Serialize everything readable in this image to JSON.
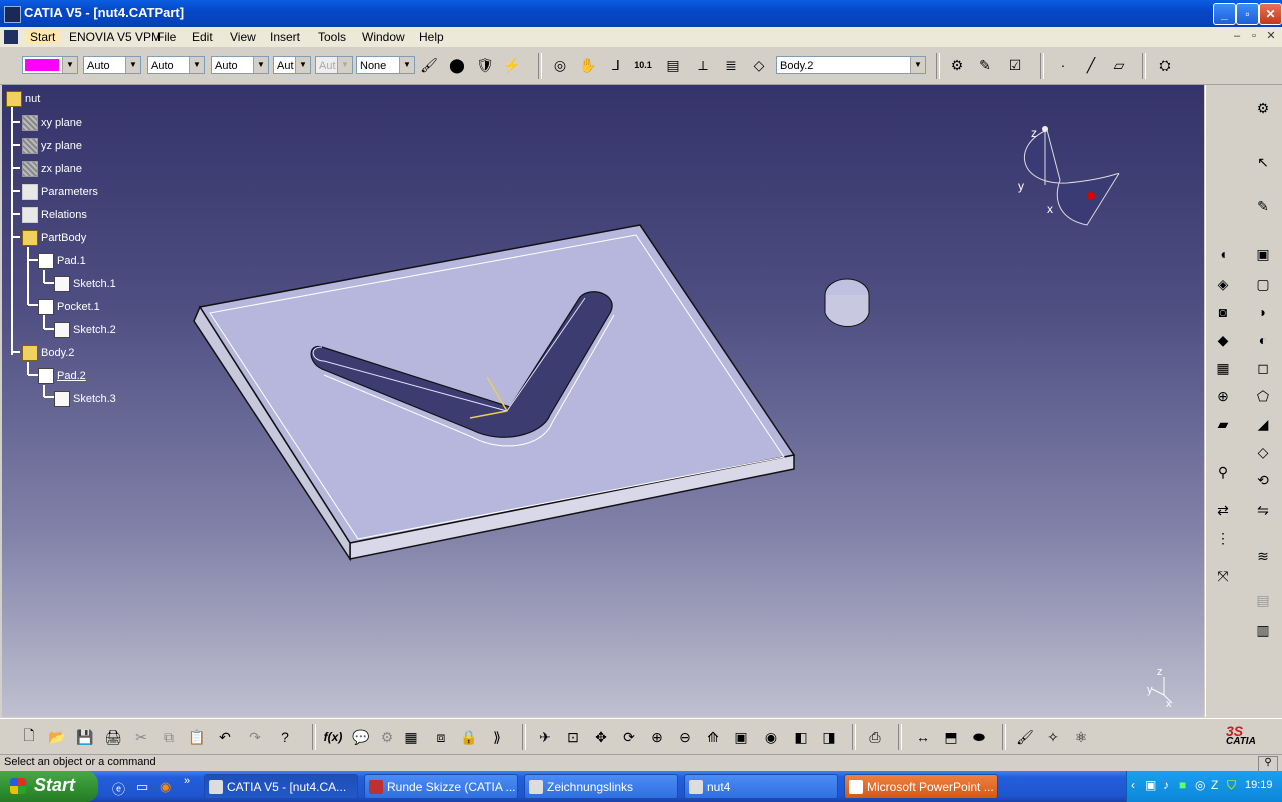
{
  "window": {
    "title": "CATIA V5 - [nut4.CATPart]"
  },
  "menu": {
    "items": [
      "Start",
      "ENOVIA V5 VPM",
      "File",
      "Edit",
      "View",
      "Insert",
      "Tools",
      "Window",
      "Help"
    ]
  },
  "toolbar": {
    "color_swatch": "#ff00ff",
    "linetype": "Auto",
    "thickness": "Auto",
    "point_style": "Auto",
    "layer": "Aut",
    "layer2": "Aut",
    "render": "None",
    "body_selector": "Body.2"
  },
  "tree": {
    "root": "nut",
    "items": [
      {
        "label": "xy plane"
      },
      {
        "label": "yz plane"
      },
      {
        "label": "zx plane"
      },
      {
        "label": "Parameters"
      },
      {
        "label": "Relations"
      },
      {
        "label": "PartBody"
      },
      {
        "label": "Pad.1"
      },
      {
        "label": "Sketch.1"
      },
      {
        "label": "Pocket.1"
      },
      {
        "label": "Sketch.2"
      },
      {
        "label": "Body.2"
      },
      {
        "label": "Pad.2"
      },
      {
        "label": "Sketch.3"
      }
    ]
  },
  "compass": {
    "x": "x",
    "y": "y",
    "z": "z"
  },
  "axis_small": {
    "x": "x",
    "y": "y",
    "z": "z"
  },
  "status": {
    "message": "Select an object or a command"
  },
  "taskbar": {
    "start": "Start",
    "tasks": [
      {
        "label": "CATIA V5 - [nut4.CA..."
      },
      {
        "label": "Runde Skizze (CATIA ..."
      },
      {
        "label": "Zeichnungslinks"
      },
      {
        "label": "nut4"
      },
      {
        "label": "Microsoft PowerPoint ..."
      }
    ],
    "clock": "19:19"
  },
  "brand": {
    "logo_text": "CATIA"
  }
}
